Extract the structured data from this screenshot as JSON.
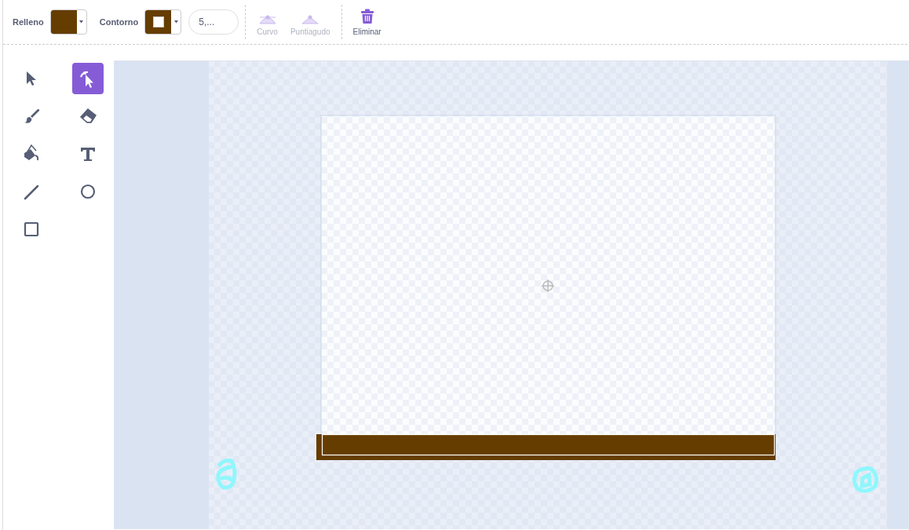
{
  "toolbar": {
    "fill": {
      "label": "Relleno",
      "color": "#663d00"
    },
    "outline": {
      "label": "Contorno",
      "color": "#663d00"
    },
    "stroke_width": {
      "value": "5,..."
    },
    "buttons": [
      {
        "kind": "curve",
        "label": "Curvo",
        "disabled": true
      },
      {
        "kind": "pointed",
        "label": "Puntiagudo",
        "disabled": true
      },
      {
        "kind": "delete",
        "label": "Eliminar",
        "disabled": false
      }
    ]
  },
  "tools": [
    {
      "kind": "select",
      "selected": false
    },
    {
      "kind": "reshape",
      "selected": true
    },
    {
      "kind": "brush",
      "selected": false
    },
    {
      "kind": "eraser",
      "selected": false
    },
    {
      "kind": "fill",
      "selected": false
    },
    {
      "kind": "text",
      "selected": false
    },
    {
      "kind": "line",
      "selected": false
    },
    {
      "kind": "circle",
      "selected": false
    },
    {
      "kind": "rect",
      "selected": false
    }
  ]
}
